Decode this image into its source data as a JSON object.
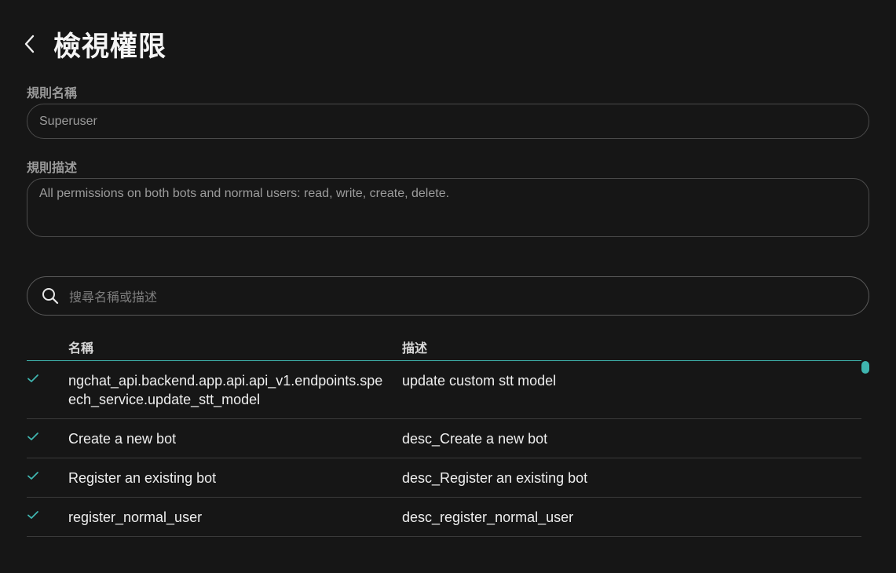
{
  "header": {
    "title": "檢視權限",
    "back_icon": "chevron-left-icon"
  },
  "rule_name": {
    "label": "規則名稱",
    "value": "Superuser"
  },
  "rule_description": {
    "label": "規則描述",
    "value": "All permissions on both bots and normal users: read, write, create, delete."
  },
  "search": {
    "icon": "search-icon",
    "placeholder": "搜尋名稱或描述"
  },
  "table": {
    "columns": {
      "name": "名稱",
      "description": "描述"
    },
    "rows": [
      {
        "checked": true,
        "name": "ngchat_api.backend.app.api.api_v1.endpoints.speech_service.update_stt_model",
        "description": "update custom stt model"
      },
      {
        "checked": true,
        "name": "Create a new bot",
        "description": "desc_Create a new bot"
      },
      {
        "checked": true,
        "name": "Register an existing bot",
        "description": "desc_Register an existing bot"
      },
      {
        "checked": true,
        "name": "register_normal_user",
        "description": "desc_register_normal_user"
      }
    ]
  },
  "colors": {
    "background": "#161616",
    "accent": "#3fb6b0",
    "check": "#3fb6b0",
    "border": "#4a4a4a"
  }
}
